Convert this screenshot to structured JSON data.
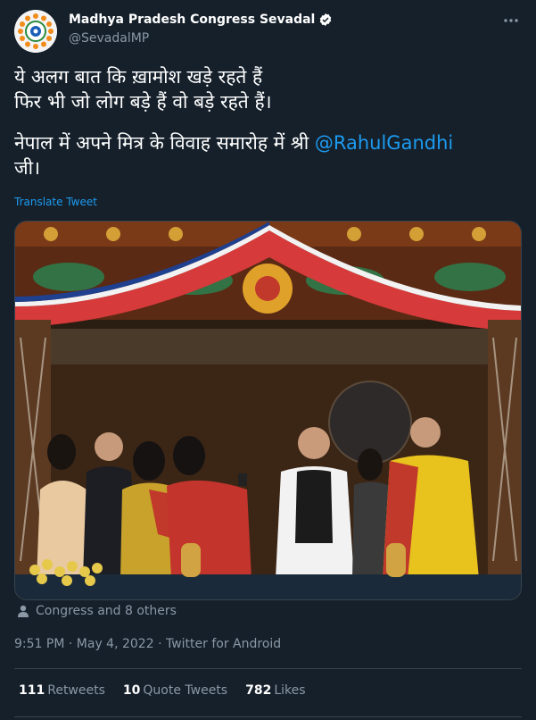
{
  "author": {
    "display_name": "Madhya Pradesh Congress Sevadal",
    "handle": "@SevadalMP",
    "verified_icon": "verified-badge-icon",
    "avatar_icon": "sevadal-logo-avatar"
  },
  "more_icon": "more-options-icon",
  "tweet": {
    "line1": "ये अलग बात कि ख़ामोश खड़े रहते हैं",
    "line2": "फिर भी जो लोग बड़े हैं वो बड़े रहते हैं।",
    "line3_prefix": "नेपाल में अपने मित्र के विवाह समारोह में श्री ",
    "mention": "@RahulGandhi",
    "line4": "जी।"
  },
  "translate_label": "Translate Tweet",
  "media": {
    "kind": "photo",
    "description_icon": "tweet-photo"
  },
  "likers": {
    "icon": "person-icon",
    "text": "Congress and 8 others"
  },
  "meta": {
    "time": "9:51 PM",
    "separator1": " · ",
    "date": "May 4, 2022",
    "separator2": " · ",
    "source": "Twitter for Android"
  },
  "stats": {
    "retweets_count": "111",
    "retweets_label": "Retweets",
    "quotes_count": "10",
    "quotes_label": "Quote Tweets",
    "likes_count": "782",
    "likes_label": "Likes"
  },
  "colors": {
    "background": "#15202b",
    "text": "#ffffff",
    "secondary": "#8b98a5",
    "accent": "#1d9bf0",
    "border": "#38444d"
  }
}
